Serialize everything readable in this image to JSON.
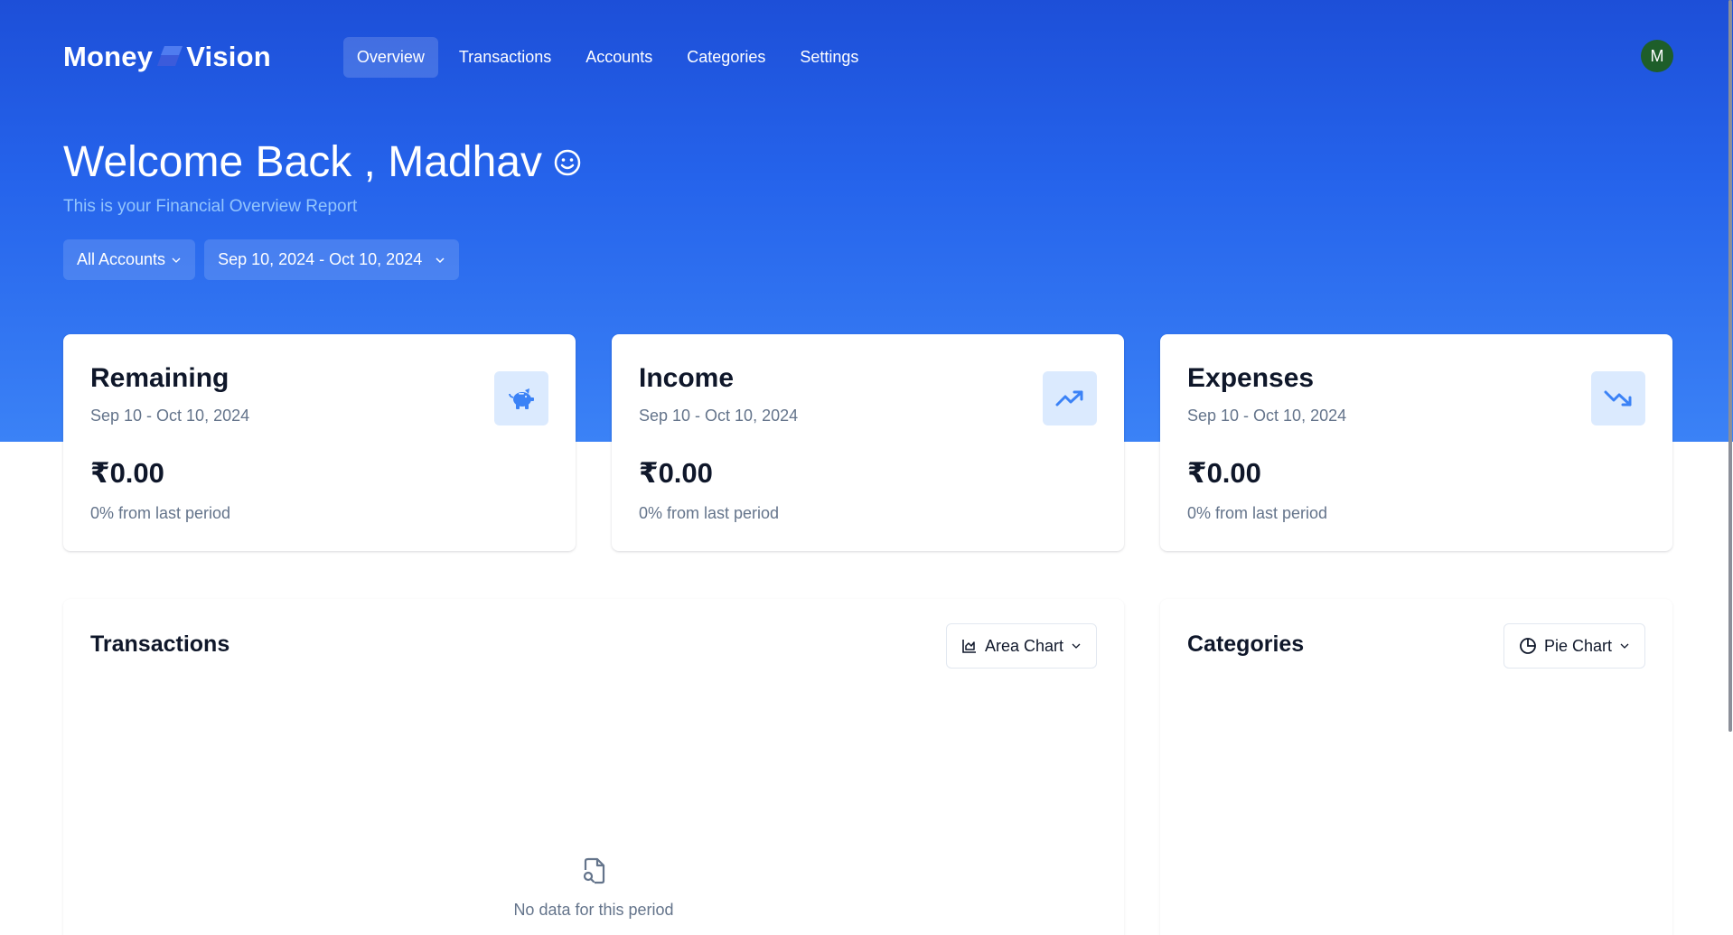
{
  "app": {
    "logo_left": "Money",
    "logo_right": "Vision",
    "avatar_initial": "M"
  },
  "nav": {
    "items": [
      {
        "label": "Overview",
        "active": true
      },
      {
        "label": "Transactions",
        "active": false
      },
      {
        "label": "Accounts",
        "active": false
      },
      {
        "label": "Categories",
        "active": false
      },
      {
        "label": "Settings",
        "active": false
      }
    ]
  },
  "header": {
    "welcome": "Welcome Back , Madhav",
    "subtitle": "This is your Financial Overview Report",
    "account_filter": "All Accounts",
    "date_filter": "Sep 10, 2024 - Oct 10, 2024"
  },
  "cards": [
    {
      "title": "Remaining",
      "date_range": "Sep 10 - Oct 10, 2024",
      "amount": "₹0.00",
      "change": "0% from last period",
      "icon": "piggy-bank-icon"
    },
    {
      "title": "Income",
      "date_range": "Sep 10 - Oct 10, 2024",
      "amount": "₹0.00",
      "change": "0% from last period",
      "icon": "trending-up-icon"
    },
    {
      "title": "Expenses",
      "date_range": "Sep 10 - Oct 10, 2024",
      "amount": "₹0.00",
      "change": "0% from last period",
      "icon": "trending-down-icon"
    }
  ],
  "transactions_panel": {
    "title": "Transactions",
    "chart_type_label": "Area Chart",
    "empty_text": "No data for this period"
  },
  "categories_panel": {
    "title": "Categories",
    "chart_type_label": "Pie Chart"
  },
  "colors": {
    "brand_blue": "#2563eb",
    "icon_blue": "#3b82f6",
    "icon_bg": "#dbeafe",
    "avatar_green": "#1e5e2a"
  }
}
